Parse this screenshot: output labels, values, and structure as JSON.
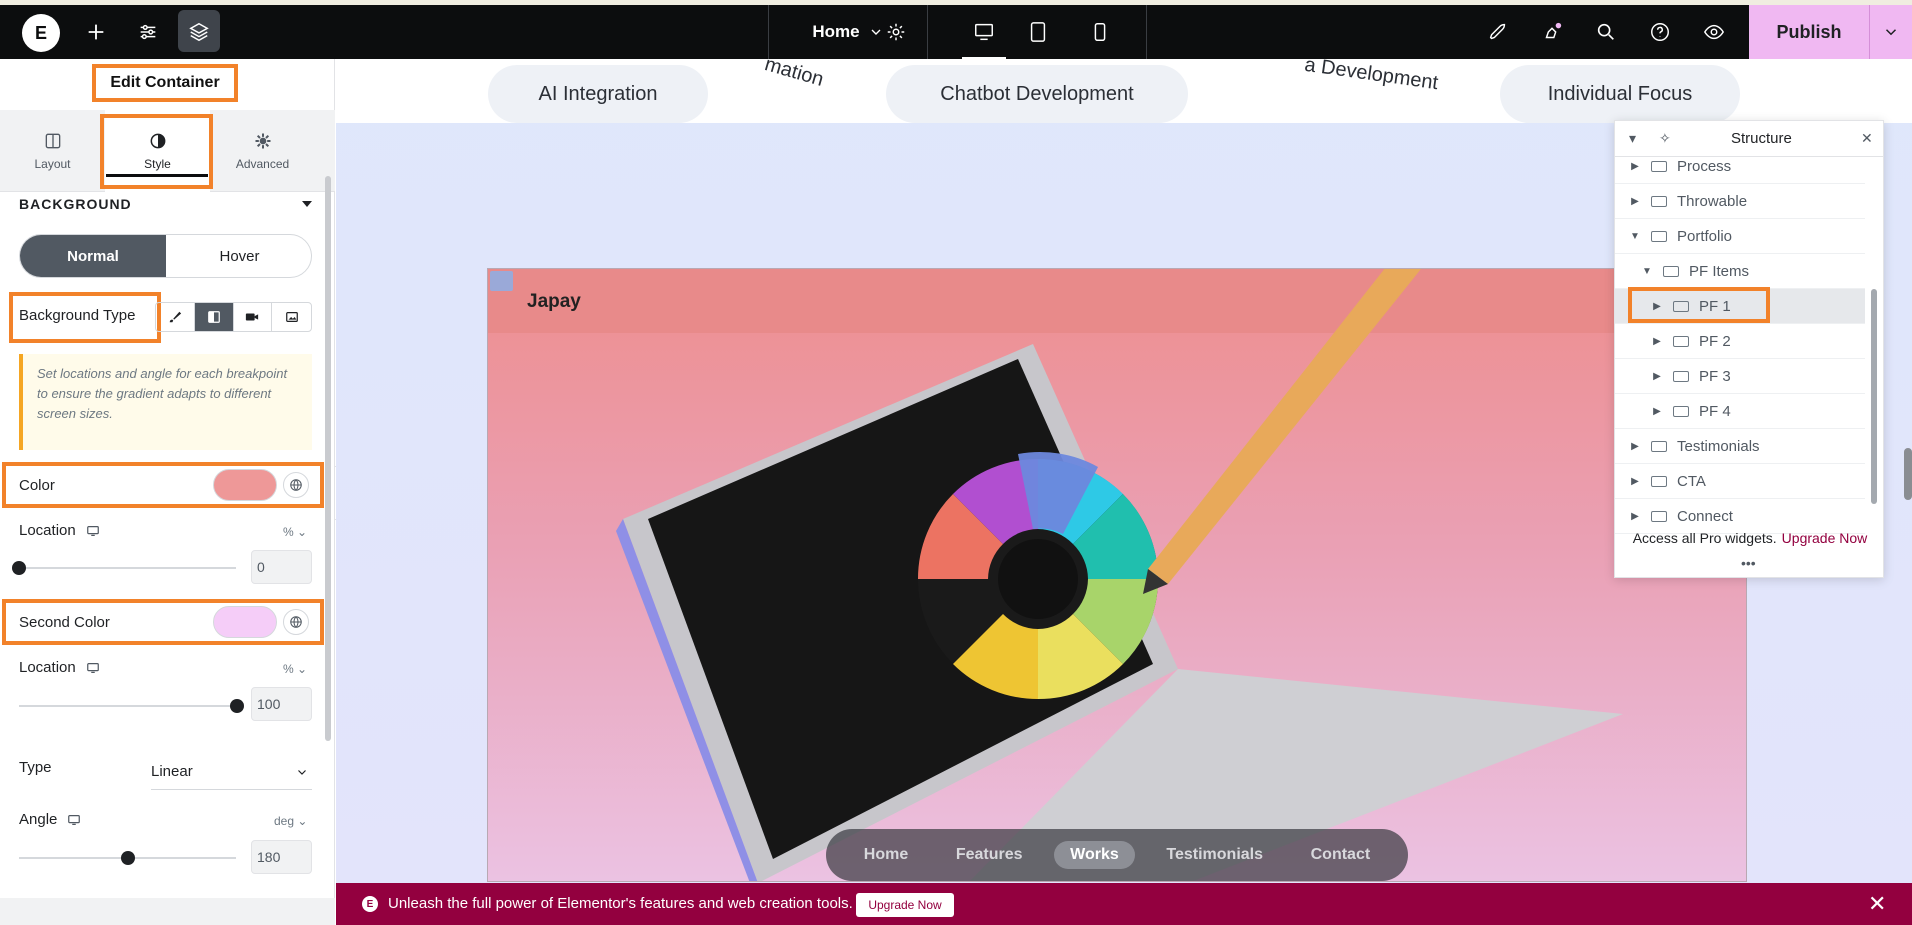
{
  "topbar": {
    "logo_text": "E",
    "page_name": "Home",
    "publish_label": "Publish",
    "icons": [
      "add-icon",
      "settings-sliders-icon",
      "layers-icon",
      "gear-icon",
      "desktop-icon",
      "tablet-icon",
      "mobile-icon",
      "rocket-icon",
      "notifications-icon",
      "search-icon",
      "help-icon",
      "preview-eye-icon",
      "chevron-down-icon"
    ]
  },
  "panel": {
    "title": "Edit Container",
    "tabs": [
      {
        "label": "Layout",
        "icon": "layout-icon"
      },
      {
        "label": "Style",
        "icon": "contrast-icon"
      },
      {
        "label": "Advanced",
        "icon": "gear-icon"
      }
    ],
    "active_tab": "Style",
    "section_title": "BACKGROUND",
    "state_toggle": {
      "normal": "Normal",
      "hover": "Hover",
      "active": "Normal"
    },
    "background_type_label": "Background Type",
    "background_type_active": "gradient",
    "notice": "Set locations and angle for each breakpoint to ensure the gradient adapts to different screen sizes.",
    "color": {
      "label": "Color",
      "value": "#ee9898"
    },
    "location1": {
      "label": "Location",
      "unit": "% ⌄",
      "value": "0"
    },
    "second_color": {
      "label": "Second Color",
      "value": "#f5cdf8"
    },
    "location2": {
      "label": "Location",
      "unit": "% ⌄",
      "value": "100"
    },
    "type": {
      "label": "Type",
      "value": "Linear"
    },
    "angle": {
      "label": "Angle",
      "unit": "deg ⌄",
      "value": "180"
    }
  },
  "canvas": {
    "pills": [
      "AI Integration",
      "Chatbot Development",
      "Individual Focus"
    ],
    "rotated_fragments": [
      "mation",
      "a Development"
    ],
    "card_title": "Japay",
    "nav": [
      "Home",
      "Features",
      "Works",
      "Testimonials",
      "Contact"
    ],
    "nav_active": "Works"
  },
  "promo": {
    "text": "Unleash the full power of Elementor's features and web creation tools.",
    "button": "Upgrade Now"
  },
  "structure": {
    "title": "Structure",
    "items": [
      {
        "label": "Process",
        "depth": 0
      },
      {
        "label": "Throwable",
        "depth": 0
      },
      {
        "label": "Portfolio",
        "depth": 0,
        "expanded": true
      },
      {
        "label": "PF Items",
        "depth": 1,
        "expanded": true
      },
      {
        "label": "PF 1",
        "depth": 2,
        "selected": true
      },
      {
        "label": "PF 2",
        "depth": 2
      },
      {
        "label": "PF 3",
        "depth": 2
      },
      {
        "label": "PF 4",
        "depth": 2
      },
      {
        "label": "Testimonials",
        "depth": 0
      },
      {
        "label": "CTA",
        "depth": 0
      },
      {
        "label": "Connect",
        "depth": 0
      }
    ],
    "footer_text": "Access all Pro widgets.",
    "footer_link": "Upgrade Now"
  }
}
